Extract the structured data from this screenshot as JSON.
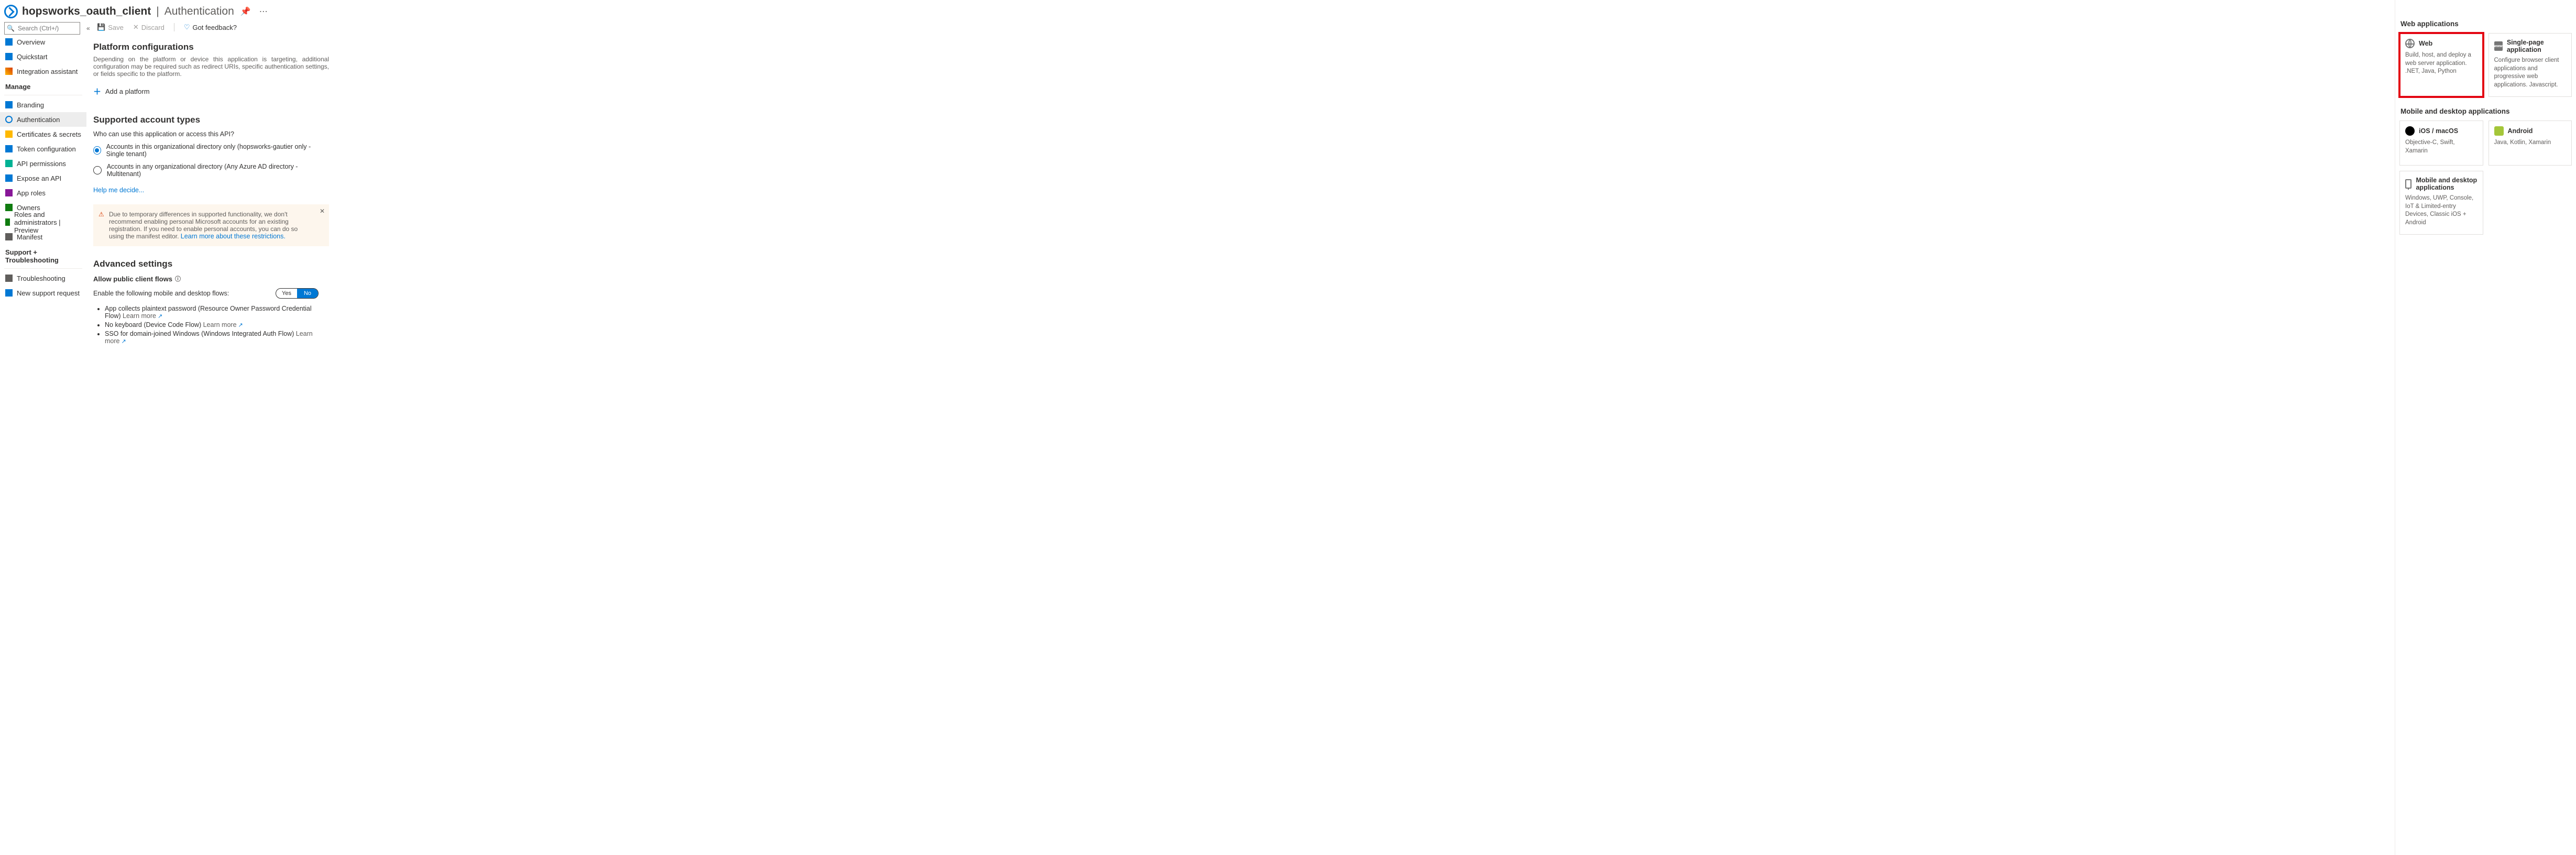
{
  "title": {
    "name": "hopsworks_oauth_client",
    "section": "Authentication"
  },
  "search": {
    "placeholder": "Search (Ctrl+/)"
  },
  "cmdbar": {
    "save": "Save",
    "discard": "Discard",
    "feedback": "Got feedback?"
  },
  "sidebar": {
    "top": [
      {
        "label": "Overview"
      },
      {
        "label": "Quickstart"
      },
      {
        "label": "Integration assistant"
      }
    ],
    "manage_header": "Manage",
    "manage": [
      {
        "label": "Branding"
      },
      {
        "label": "Authentication"
      },
      {
        "label": "Certificates & secrets"
      },
      {
        "label": "Token configuration"
      },
      {
        "label": "API permissions"
      },
      {
        "label": "Expose an API"
      },
      {
        "label": "App roles"
      },
      {
        "label": "Owners"
      },
      {
        "label": "Roles and administrators | Preview"
      },
      {
        "label": "Manifest"
      }
    ],
    "support_header": "Support + Troubleshooting",
    "support": [
      {
        "label": "Troubleshooting"
      },
      {
        "label": "New support request"
      }
    ]
  },
  "platform": {
    "heading": "Platform configurations",
    "desc": "Depending on the platform or device this application is targeting, additional configuration may be required such as redirect URIs, specific authentication settings, or fields specific to the platform.",
    "add": "Add a platform"
  },
  "accounts": {
    "heading": "Supported account types",
    "question": "Who can use this application or access this API?",
    "opt1": "Accounts in this organizational directory only (hopsworks-gautier only - Single tenant)",
    "opt2": "Accounts in any organizational directory (Any Azure AD directory - Multitenant)",
    "help": "Help me decide..."
  },
  "warning": {
    "text": "Due to temporary differences in supported functionality, we don't recommend enabling personal Microsoft accounts for an existing registration. If you need to enable personal accounts, you can do so using the manifest editor. ",
    "link": "Learn more about these restrictions."
  },
  "advanced": {
    "heading": "Advanced settings",
    "allow": "Allow public client flows",
    "enable_text": "Enable the following mobile and desktop flows:",
    "toggle": {
      "yes": "Yes",
      "no": "No"
    },
    "flows": [
      {
        "text": "App collects plaintext password (Resource Owner Password Credential Flow)",
        "lm": "Learn more"
      },
      {
        "text": "No keyboard (Device Code Flow)",
        "lm": "Learn more"
      },
      {
        "text": "SSO for domain-joined Windows (Windows Integrated Auth Flow)",
        "lm": "Learn more"
      }
    ]
  },
  "panel": {
    "web_header": "Web applications",
    "web": {
      "title": "Web",
      "desc": "Build, host, and deploy a web server application. .NET, Java, Python"
    },
    "spa": {
      "title": "Single-page application",
      "desc": "Configure browser client applications and progressive web applications. Javascript."
    },
    "mob_header": "Mobile and desktop applications",
    "ios": {
      "title": "iOS / macOS",
      "desc": "Objective-C, Swift, Xamarin"
    },
    "android": {
      "title": "Android",
      "desc": "Java, Kotlin, Xamarin"
    },
    "desktop": {
      "title": "Mobile and desktop applications",
      "desc": "Windows, UWP, Console, IoT & Limited-entry Devices, Classic iOS + Android"
    }
  }
}
